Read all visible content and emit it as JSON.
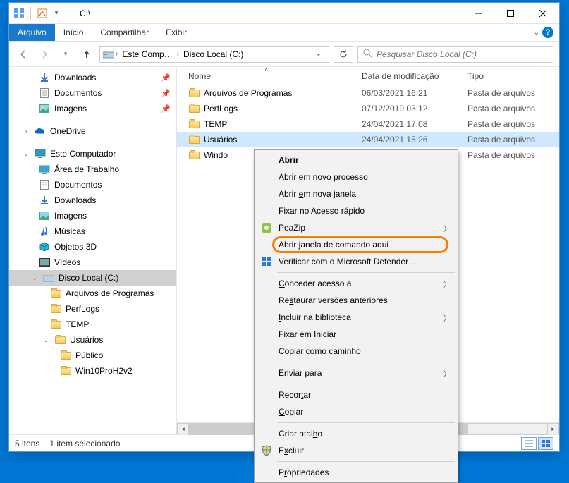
{
  "window": {
    "title": "C:\\"
  },
  "tabs": {
    "file": "Arquivo",
    "home": "Início",
    "share": "Compartilhar",
    "view": "Exibir"
  },
  "breadcrumb": {
    "item1": "Este Comp…",
    "item2": "Disco Local (C:)"
  },
  "search": {
    "placeholder": "Pesquisar Disco Local (C:)"
  },
  "columns": {
    "name": "Nome",
    "date": "Data de modificação",
    "type": "Tipo"
  },
  "nav": {
    "downloads": "Downloads",
    "documentos": "Documentos",
    "imagens": "Imagens",
    "onedrive": "OneDrive",
    "este_pc": "Este Computador",
    "desktop": "Área de Trabalho",
    "documentos2": "Documentos",
    "downloads2": "Downloads",
    "imagens2": "Imagens",
    "musicas": "Músicas",
    "objetos3d": "Objetos 3D",
    "videos": "Vídeos",
    "disco_c": "Disco Local (C:)",
    "arq_prog": "Arquivos de Programas",
    "perflogs": "PerfLogs",
    "temp": "TEMP",
    "usuarios": "Usuários",
    "publico": "Público",
    "winproh": "Win10ProH2v2"
  },
  "files": [
    {
      "name": "Arquivos de Programas",
      "date": "06/03/2021 16:21",
      "type": "Pasta de arquivos"
    },
    {
      "name": "PerfLogs",
      "date": "07/12/2019 03:12",
      "type": "Pasta de arquivos"
    },
    {
      "name": "TEMP",
      "date": "24/04/2021 17:08",
      "type": "Pasta de arquivos"
    },
    {
      "name": "Usuários",
      "date": "24/04/2021 15:26",
      "type": "Pasta de arquivos"
    },
    {
      "name": "Windo",
      "date": "",
      "type": "Pasta de arquivos"
    }
  ],
  "status": {
    "count": "5 itens",
    "selected": "1 item selecionado"
  },
  "ctx": {
    "open": "Abrir",
    "open_new_proc": "Abrir em novo processo",
    "open_new_win": "Abrir em nova janela",
    "pin_quick": "Fixar no Acesso rápido",
    "peazip": "PeaZip",
    "cmd_here": "Abrir janela de comando aqui",
    "defender": "Verificar com o Microsoft Defender…",
    "give_access": "Conceder acesso a",
    "restore": "Restaurar versões anteriores",
    "include_lib": "Incluir na biblioteca",
    "pin_start": "Fixar em Iniciar",
    "copy_path": "Copiar como caminho",
    "send_to": "Enviar para",
    "cut": "Recortar",
    "copy": "Copiar",
    "shortcut": "Criar atalho",
    "delete": "Excluir",
    "properties": "Propriedades"
  }
}
